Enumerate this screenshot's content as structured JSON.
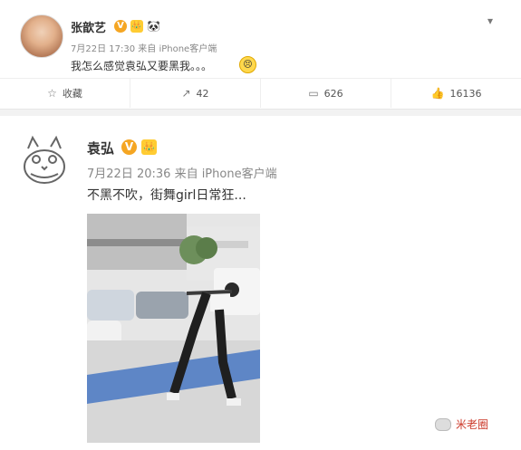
{
  "post1": {
    "username": "张歆艺",
    "badges": [
      "V",
      "👑",
      "🐼"
    ],
    "time": "7月22日 17:30",
    "source": "来自 iPhone客户端",
    "text": "我怎么感觉袁弘又要黑我。。。",
    "emoji": "😣",
    "actions": {
      "favorite_label": "收藏",
      "repost_count": "42",
      "comment_count": "626",
      "like_count": "16136"
    },
    "icons": {
      "favorite": "star-icon",
      "repost": "share-icon",
      "comment": "comment-icon",
      "like": "thumbs-up-icon",
      "more": "chevron-down-icon"
    }
  },
  "post2": {
    "username": "袁弘",
    "badges": [
      "V",
      "👑"
    ],
    "time": "7月22日 20:36",
    "source": "来自 iPhone客户端",
    "text": "不黑不吹，街舞girl日常狂..."
  },
  "watermark": {
    "text": "米老圈"
  }
}
